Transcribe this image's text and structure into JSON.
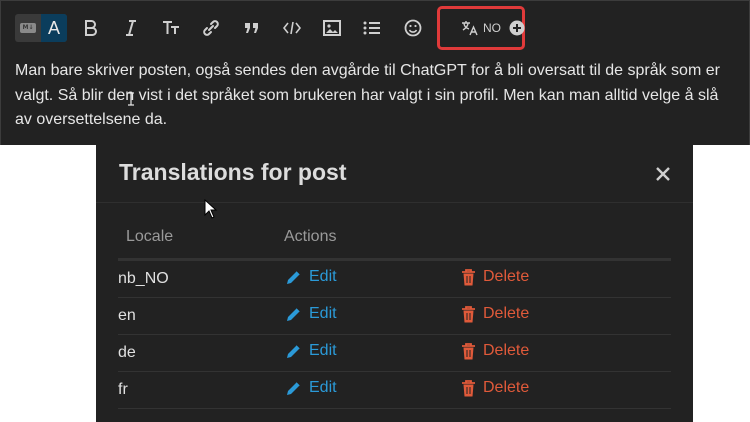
{
  "toolbar": {
    "md_badge": "M↓",
    "rich_letter": "A",
    "translate_locale": "NO",
    "icons": [
      "markdown-icon",
      "bold-icon",
      "italic-icon",
      "text-size-icon",
      "link-icon",
      "quote-icon",
      "code-icon",
      "image-icon",
      "list-icon",
      "emoji-icon",
      "translate-icon",
      "plus-circle-icon"
    ]
  },
  "editor": {
    "text": "Man bare skriver posten, også sendes den avgårde til ChatGPT for å bli oversatt til de språk som er valgt. Så blir den vist i det språket som brukeren har valgt i sin profil. Men kan man alltid velge å slå av oversettelsene da."
  },
  "modal": {
    "title": "Translations for post",
    "columns": {
      "locale": "Locale",
      "actions": "Actions"
    },
    "rows": [
      {
        "locale": "nb_NO",
        "edit": "Edit",
        "delete": "Delete"
      },
      {
        "locale": "en",
        "edit": "Edit",
        "delete": "Delete"
      },
      {
        "locale": "de",
        "edit": "Edit",
        "delete": "Delete"
      },
      {
        "locale": "fr",
        "edit": "Edit",
        "delete": "Delete"
      }
    ]
  },
  "colors": {
    "accent_edit": "#2b9ad8",
    "accent_delete": "#e05a3a",
    "highlight_border": "#e03a3a",
    "background": "#222222"
  }
}
